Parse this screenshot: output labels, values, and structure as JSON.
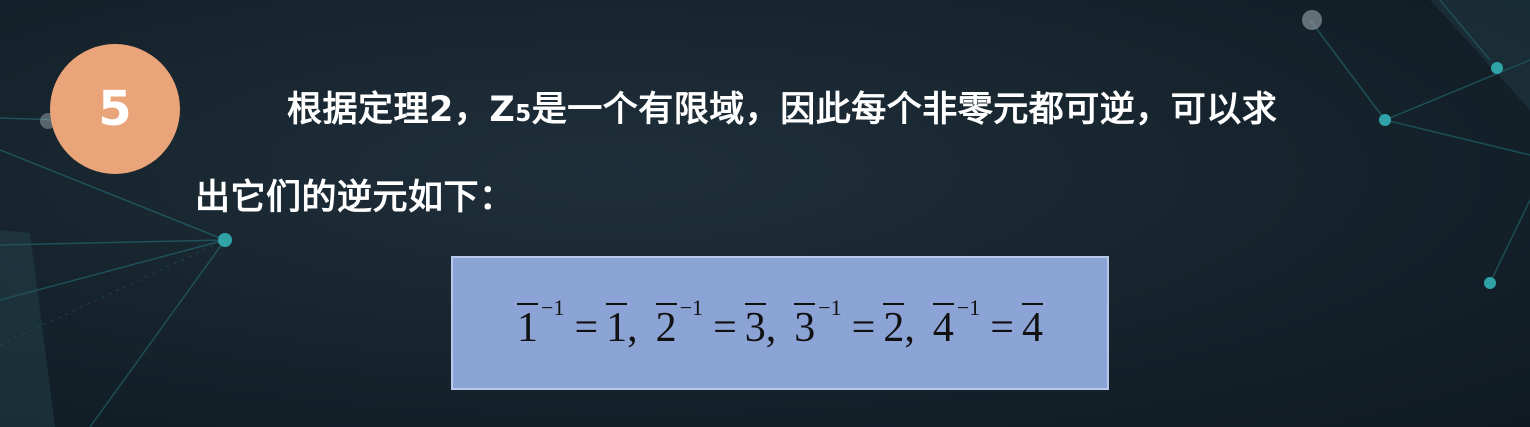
{
  "badge": {
    "number": "5"
  },
  "text": {
    "line1_a": "根据定理2，Z",
    "subscript": "5",
    "line1_b": "是一个有限域，因此每个非零元都可逆，可以求",
    "line2": "出它们的逆元如下："
  },
  "formula": {
    "exponent": "−1",
    "equals": "=",
    "separator": ",",
    "pairs": [
      {
        "base": "1",
        "inverse": "1"
      },
      {
        "base": "2",
        "inverse": "3"
      },
      {
        "base": "3",
        "inverse": "2"
      },
      {
        "base": "4",
        "inverse": "4"
      }
    ]
  },
  "colors": {
    "background": "#16232c",
    "badge": "#e9a47a",
    "formula_box": "#8ca3d6",
    "text": "#ffffff",
    "network_lines": "#2fa3a8"
  }
}
